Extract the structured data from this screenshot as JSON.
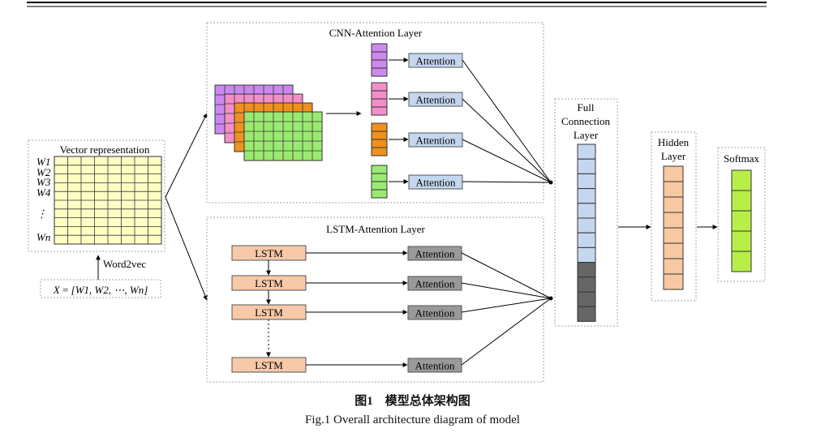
{
  "input": {
    "title": "Vector representation",
    "row_labels": [
      "W1",
      "W2",
      "W3",
      "W4",
      "⋮",
      "Wn"
    ],
    "embedding_label": "Word2vec",
    "formula": "X = [W1, W2, ⋯, Wn]"
  },
  "cnn": {
    "title": "CNN-Attention  Layer",
    "attention_labels": [
      "Attention",
      "Attention",
      "Attention",
      "Attention"
    ],
    "feature_map_colors": [
      "#cc88ee",
      "#f28fc8",
      "#f0901e",
      "#9bea70"
    ]
  },
  "lstm": {
    "title": "LSTM-Attention  Layer",
    "cells": [
      "LSTM",
      "LSTM",
      "LSTM",
      "LSTM"
    ],
    "attention_labels": [
      "Attention",
      "Attention",
      "Attention",
      "Attention"
    ]
  },
  "full_connection": {
    "label_lines": [
      "Full",
      "Connection",
      "Layer"
    ]
  },
  "hidden": {
    "label_lines": [
      "Hidden",
      "Layer"
    ]
  },
  "softmax": {
    "label": "Softmax"
  },
  "captions": {
    "cn": "图1　模型总体架构图",
    "en": "Fig.1   Overall  architecture  diagram  of  model"
  },
  "colors": {
    "grid_yellow": "#ffffc4",
    "attention_blue": "#c4d7ee",
    "attention_gray": "#999999",
    "lstm_peach": "#f7c9a8",
    "fc_blue": "#c4d7ee",
    "fc_dark": "#666666",
    "hidden_orange": "#f7c9a0",
    "softmax_green": "#b8ee48"
  }
}
